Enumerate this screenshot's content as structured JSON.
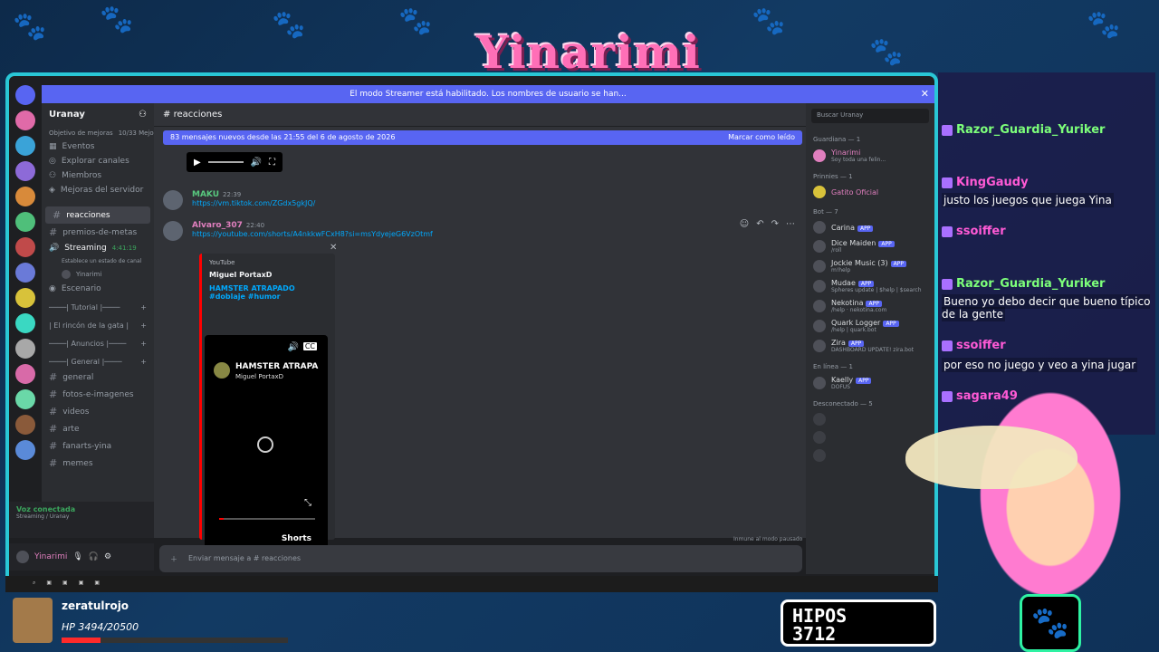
{
  "overlay": {
    "logo_text": "Yinarimi",
    "hipos_line1": "HIPOS",
    "hipos_line2": "3712",
    "sub_name": "zeratulrojo",
    "sub_hp": "HP 3494/20500",
    "hp_fraction": 0.17
  },
  "discord": {
    "banner": "El modo Streamer está habilitado. Los nombres de usuario se han...",
    "server_name": "Uranay",
    "boost_goal": "Objetivo de mejoras",
    "boost_count": "10/33 Mejoras",
    "nav": [
      "Eventos",
      "Explorar canales",
      "Miembros",
      "Mejoras del servidor"
    ],
    "channels": {
      "active": "reacciones",
      "goals": "premios-de-metas",
      "streaming": "Streaming",
      "streaming_time": "4:41:19",
      "streaming_status": "Establece un estado de canal",
      "streaming_user": "Yinarimi",
      "stage": "Escenario",
      "cat_tutorial": "────| Tutorial |────",
      "cat_rincon": "| El rincón de la gata |",
      "cat_anuncios": "────| Anuncios |────",
      "cat_general": "────| General |────",
      "general": "general",
      "fotos": "fotos-e-imagenes",
      "videos": "videos",
      "arte": "arte",
      "fanarts": "fanarts-yina",
      "memes": "memes"
    },
    "voice_connected": "Voz conectada",
    "voice_sub": "Streaming / Uranay",
    "user_name": "Yinarimi",
    "chat_channel": "reacciones",
    "new_messages": "83 mensajes nuevos desde las 21:55 del 6 de agosto de 2026",
    "mark_read": "Marcar como leído",
    "messages": [
      {
        "author": "MAKU",
        "time": "22:39",
        "text": "https://vm.tiktok.com/ZGdx5gkJQ/"
      },
      {
        "author": "Alvaro_307",
        "time": "22:40",
        "text": "https://youtube.com/shorts/A4nkkwFCxH8?si=msYdyejeG6VzOtmf"
      }
    ],
    "embed": {
      "provider": "YouTube",
      "author": "Miguel PortaxD",
      "title": "HAMSTER ATRAPADO #doblaje #humor",
      "video_title": "HAMSTER ATRAPA",
      "video_channel": "Miguel PortaxD",
      "shorts": "Shorts",
      "progress": 0.05
    },
    "input_placeholder": "Enviar mensaje a # reacciones",
    "paused_note": "Inmune al modo pausado",
    "search_placeholder": "Buscar Uranay",
    "member_sections": {
      "guardiana": "Guardiana — 1",
      "prinnies": "Prinnies — 1",
      "bot": "Bot — 7",
      "online": "En línea — 1",
      "offline": "Desconectado — 5"
    },
    "members": {
      "guardiana": [
        {
          "name": "Yinarimi",
          "sub": "Soy toda una felin..."
        }
      ],
      "prinnies": [
        {
          "name": "Gatito Oficial",
          "sub": ""
        }
      ],
      "bots": [
        {
          "name": "Carina",
          "sub": ""
        },
        {
          "name": "Dice Maiden",
          "sub": "/roll"
        },
        {
          "name": "Jockie Music (3)",
          "sub": "m!help"
        },
        {
          "name": "Mudae",
          "sub": "Spheres update | $help | $search"
        },
        {
          "name": "Nekotina",
          "sub": "/help · nekotina.com"
        },
        {
          "name": "Quark Logger",
          "sub": "/help | quark.bot"
        },
        {
          "name": "Zira",
          "sub": "DASHBOARD UPDATE! zira.bot"
        }
      ],
      "online": [
        {
          "name": "Kaelly",
          "sub": "DOFUS"
        }
      ],
      "app_label": "APP"
    }
  },
  "stream_chat": [
    {
      "name": "Razor_Guardia_Yuriker",
      "text": ""
    },
    {
      "name": "KingGaudy",
      "text": "justo los juegos que juega Yina"
    },
    {
      "name": "ssoiffer",
      "text": ""
    },
    {
      "name": "Razor_Guardia_Yuriker",
      "text": "Bueno yo debo decir que bueno típico de la gente"
    },
    {
      "name": "ssoiffer",
      "text": "por eso no juego y veo a yina jugar"
    },
    {
      "name": "sagara49",
      "text": ""
    }
  ],
  "colors": {
    "frame": "#29c7d6",
    "blurple": "#5865f2",
    "chat_name": "#ff5ad6",
    "hp": "#ff2a2a"
  }
}
